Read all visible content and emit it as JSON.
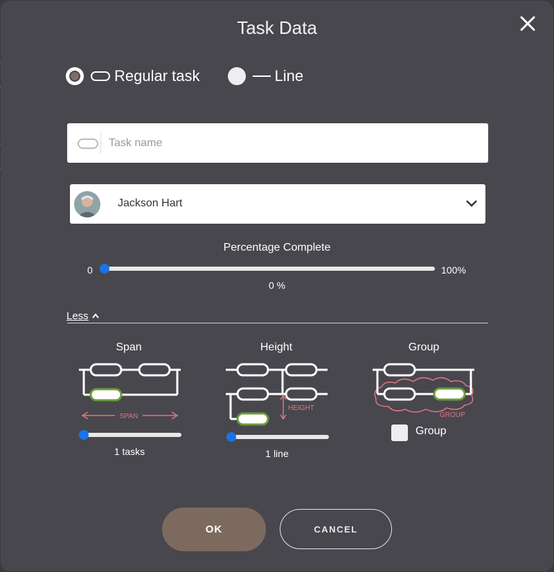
{
  "dialog": {
    "title": "Task Data"
  },
  "task_type": {
    "regular_label": "Regular task",
    "line_label": "Line",
    "selected": "regular"
  },
  "task_name": {
    "value": "",
    "placeholder": "Task name"
  },
  "assignee": {
    "name": "Jackson Hart"
  },
  "progress": {
    "label": "Percentage Complete",
    "min_label": "0",
    "max_label": "100%",
    "value_text": "0 %",
    "value": 0
  },
  "toggle": {
    "less_label": "Less"
  },
  "options": {
    "span": {
      "title": "Span",
      "diagram_label": "SPAN",
      "value_text": "1 tasks",
      "value": 1
    },
    "height": {
      "title": "Height",
      "diagram_label": "HEIGHT",
      "value_text": "1 line",
      "value": 1
    },
    "group": {
      "title": "Group",
      "diagram_label": "GROUP",
      "checkbox_label": "Group",
      "checked": false
    }
  },
  "buttons": {
    "ok": "OK",
    "cancel": "CANCEL"
  },
  "colors": {
    "backdrop": "#3a3a40",
    "dialog": "#48474d",
    "ok_button": "#7d6a5f",
    "slider_thumb": "#1a73e8",
    "highlight_green": "#6a9a3a",
    "annotation_red": "#e0767e"
  },
  "icons": {
    "close": "close-icon",
    "dropdown": "chevron-down-icon",
    "less": "chevron-up-icon"
  }
}
